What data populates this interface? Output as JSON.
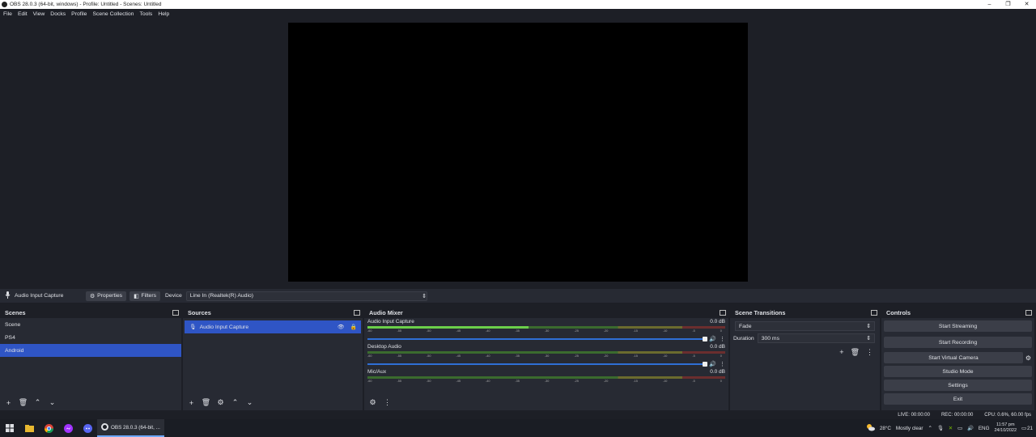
{
  "window": {
    "title": "OBS 28.0.3 (64-bit, windows) - Profile: Untitled - Scenes: Untitled",
    "minimize": "–",
    "maximize": "❐",
    "close": "✕"
  },
  "menu": [
    "File",
    "Edit",
    "View",
    "Docks",
    "Profile",
    "Scene Collection",
    "Tools",
    "Help"
  ],
  "source_bar": {
    "source_name": "Audio Input Capture",
    "properties_label": "Properties",
    "filters_label": "Filters",
    "device_label": "Device",
    "device_value": "Line In (Realtek(R) Audio)"
  },
  "scenes": {
    "header": "Scenes",
    "items": [
      "Scene",
      "PS4",
      "Android"
    ],
    "selected": "Android"
  },
  "sources": {
    "header": "Sources",
    "items": [
      "Audio Input Capture"
    ]
  },
  "mixer": {
    "header": "Audio Mixer",
    "ticks": [
      "-60",
      "-55",
      "-50",
      "-45",
      "-40",
      "-35",
      "-30",
      "-25",
      "-20",
      "-15",
      "-10",
      "-5",
      "0"
    ],
    "channels": [
      {
        "name": "Audio Input Capture",
        "db": "0.0 dB",
        "level": 0.45
      },
      {
        "name": "Desktop Audio",
        "db": "0.0 dB",
        "level": 0.0
      },
      {
        "name": "Mic/Aux",
        "db": "0.0 dB",
        "level": 0.0
      }
    ]
  },
  "transitions": {
    "header": "Scene Transitions",
    "selected": "Fade",
    "duration_label": "Duration",
    "duration_value": "300 ms"
  },
  "controls": {
    "header": "Controls",
    "buttons": [
      "Start Streaming",
      "Start Recording",
      "Start Virtual Camera",
      "Studio Mode",
      "Settings",
      "Exit"
    ]
  },
  "status": {
    "live": "LIVE: 00:00:00",
    "rec": "REC: 00:00:00",
    "cpu": "CPU: 0.6%, 60.00 fps"
  },
  "taskbar": {
    "active_app": "OBS 28.0.3 (64-bit, ...",
    "weather_temp": "28°C",
    "weather_desc": "Mostly clear",
    "lang": "ENG",
    "time": "11:57 pm",
    "date": "24/10/2022",
    "notif_count": "21"
  },
  "colors": {
    "accent": "#2f55c5",
    "panel": "#272a33",
    "background": "#1d1f26"
  }
}
